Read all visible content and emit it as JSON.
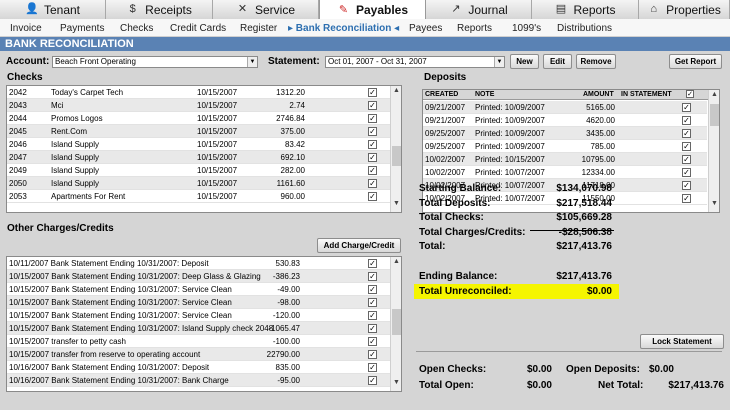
{
  "tabs": [
    {
      "label": "Tenant",
      "icon": "person-icon"
    },
    {
      "label": "Receipts",
      "icon": "dollar-icon"
    },
    {
      "label": "Service",
      "icon": "tools-icon"
    },
    {
      "label": "Payables",
      "icon": "pen-icon",
      "active": true
    },
    {
      "label": "Journal",
      "icon": "chart-icon"
    },
    {
      "label": "Reports",
      "icon": "printer-icon"
    },
    {
      "label": "Properties",
      "icon": "house-icon"
    }
  ],
  "subnav": [
    "Invoice",
    "Payments",
    "Checks",
    "Credit Cards",
    "Register",
    "Bank Reconciliation",
    "Payees",
    "Reports",
    "1099's",
    "Distributions"
  ],
  "subnav_current": "Bank Reconciliation",
  "page_title": "BANK RECONCILIATION",
  "account": {
    "label": "Account:",
    "value": "Beach Front Operating"
  },
  "statement": {
    "label": "Statement:",
    "value": "Oct 01, 2007 - Oct 31, 2007"
  },
  "buttons": {
    "new": "New",
    "edit": "Edit",
    "remove": "Remove",
    "get_report": "Get Report",
    "add_charge": "Add Charge/Credit",
    "lock": "Lock Statement"
  },
  "checks": {
    "title": "Checks",
    "rows": [
      [
        "2042",
        "Today's Carpet Tech",
        "10/15/2007",
        "1312.20"
      ],
      [
        "2043",
        "Mci",
        "10/15/2007",
        "2.74"
      ],
      [
        "2044",
        "Promos Logos",
        "10/15/2007",
        "2746.84"
      ],
      [
        "2045",
        "Rent.Com",
        "10/15/2007",
        "375.00"
      ],
      [
        "2046",
        "Island Supply",
        "10/15/2007",
        "83.42"
      ],
      [
        "2047",
        "Island Supply",
        "10/15/2007",
        "692.10"
      ],
      [
        "2049",
        "Island Supply",
        "10/15/2007",
        "282.00"
      ],
      [
        "2050",
        "Island Supply",
        "10/15/2007",
        "1161.60"
      ],
      [
        "2053",
        "Apartments For Rent",
        "10/15/2007",
        "960.00"
      ]
    ]
  },
  "deposits": {
    "title": "Deposits",
    "headers": [
      "CREATED",
      "NOTE",
      "AMOUNT",
      "IN STATEMENT"
    ],
    "rows": [
      [
        "09/21/2007",
        "Printed: 10/09/2007",
        "5165.00"
      ],
      [
        "09/21/2007",
        "Printed: 10/09/2007",
        "4620.00"
      ],
      [
        "09/25/2007",
        "Printed: 10/09/2007",
        "3435.00"
      ],
      [
        "09/25/2007",
        "Printed: 10/09/2007",
        "785.00"
      ],
      [
        "10/02/2007",
        "Printed: 10/15/2007",
        "10795.00"
      ],
      [
        "10/02/2007",
        "Printed: 10/07/2007",
        "12334.00"
      ],
      [
        "10/02/2007",
        "Printed: 10/07/2007",
        "11718.00"
      ],
      [
        "10/02/2007",
        "Printed: 10/07/2007",
        "11550.00"
      ]
    ]
  },
  "other": {
    "title": "Other Charges/Credits",
    "rows": [
      [
        "10/11/2007 Bank Statement Ending 10/31/2007: Deposit",
        "530.83"
      ],
      [
        "10/15/2007 Bank Statement Ending 10/31/2007: Deep Glass & Glazing",
        "-386.23"
      ],
      [
        "10/15/2007 Bank Statement Ending 10/31/2007: Service Clean",
        "-49.00"
      ],
      [
        "10/15/2007 Bank Statement Ending 10/31/2007: Service Clean",
        "-98.00"
      ],
      [
        "10/15/2007 Bank Statement Ending 10/31/2007: Service Clean",
        "-120.00"
      ],
      [
        "10/15/2007 Bank Statement Ending 10/31/2007: Island Supply check 2048",
        "-1065.47"
      ],
      [
        "10/15/2007 transfer to petty cash",
        "-100.00"
      ],
      [
        "10/15/2007 transfer from reserve to operating account",
        "22790.00"
      ],
      [
        "10/16/2007 Bank Statement Ending 10/31/2007: Deposit",
        "835.00"
      ],
      [
        "10/16/2007 Bank Statement Ending 10/31/2007: Bank Charge",
        "-95.00"
      ]
    ]
  },
  "summary": {
    "starting_balance": [
      "Starting Balance:",
      "$134,070.98"
    ],
    "total_deposits": [
      "Total Deposits:",
      "$217,518.44"
    ],
    "total_checks": [
      "Total Checks:",
      "$105,669.28"
    ],
    "total_charges": [
      "Total Charges/Credits:",
      "-$28,506.38"
    ],
    "total": [
      "Total:",
      "$217,413.76"
    ],
    "ending_balance": [
      "Ending Balance:",
      "$217,413.76"
    ],
    "unreconciled": [
      "Total Unreconciled:",
      "$0.00"
    ],
    "open_checks": [
      "Open Checks:",
      "$0.00"
    ],
    "open_deposits": [
      "Open Deposits:",
      "$0.00"
    ],
    "total_open": [
      "Total Open:",
      "$0.00"
    ],
    "net_total": [
      "Net Total:",
      "$217,413.76"
    ]
  },
  "colors": {
    "title_bar": "#5a82b4",
    "highlight": "#f5f500",
    "link": "#2d6fb0"
  }
}
